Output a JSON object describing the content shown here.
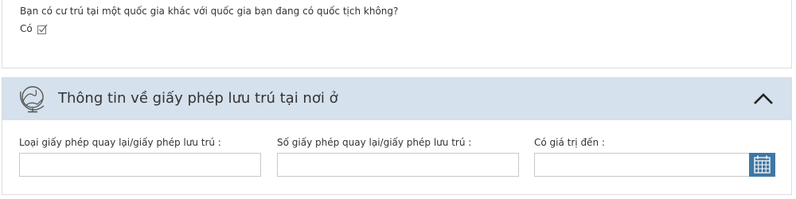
{
  "residency": {
    "question": "Bạn có cư trú tại một quốc gia khác với quốc gia bạn đang có quốc tịch không?",
    "answer": "Có"
  },
  "permit_section": {
    "title": "Thông tin về giấy phép lưu trú tại nơi ở",
    "header_bg": "#d5e1ec",
    "fields": {
      "permit_type_label": "Loại giấy phép quay lại/giấy phép lưu trú :",
      "permit_type_value": "",
      "permit_number_label": "Số giấy phép quay lại/giấy phép lưu trú :",
      "permit_number_value": "",
      "valid_until_label": "Có giá trị đến :",
      "valid_until_value": ""
    },
    "calendar_button_color": "#3f78a4"
  }
}
